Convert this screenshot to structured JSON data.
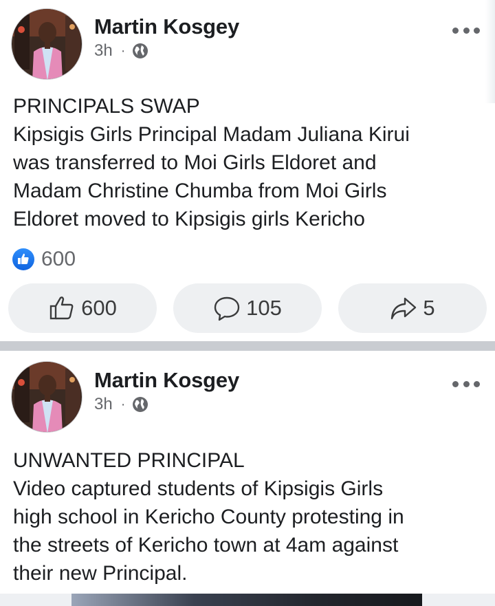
{
  "posts": [
    {
      "author": "Martin Kosgey",
      "time": "3h",
      "separator": "·",
      "audience_icon": "globe-icon",
      "lines": [
        "PRINCIPALS SWAP",
        "Kipsigis Girls Principal Madam Juliana Kirui",
        "was transferred to Moi Girls Eldoret and",
        "Madam Christine Chumba from Moi Girls",
        "Eldoret moved to Kipsigis girls Kericho"
      ],
      "reaction_count": "600",
      "actions": {
        "like": "600",
        "comment": "105",
        "share": "5"
      }
    },
    {
      "author": "Martin Kosgey",
      "time": "3h",
      "separator": "·",
      "audience_icon": "globe-icon",
      "lines": [
        "UNWANTED PRINCIPAL",
        "Video captured students of Kipsigis Girls",
        "high school in Kericho County protesting in",
        "the streets of Kericho town at 4am against",
        "their new Principal."
      ]
    }
  ],
  "colors": {
    "text": "#1c1e21",
    "secondary": "#65676b",
    "like_blue": "#1877f2",
    "button_bg": "#eef0f2",
    "divider": "#c9ccd1"
  }
}
